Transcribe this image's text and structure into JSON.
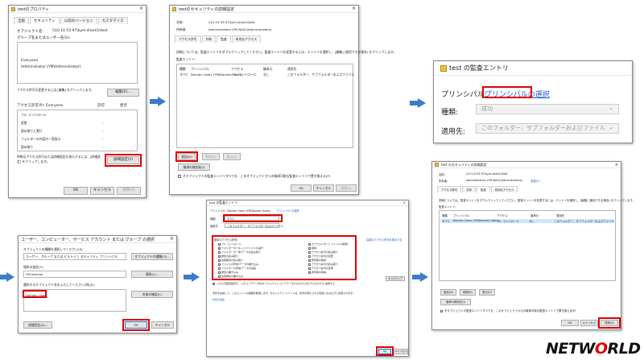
{
  "p1": {
    "title": "testのプロパティ",
    "tabs": [
      "全般",
      "セキュリティ",
      "以前のバージョン",
      "カスタマイズ"
    ],
    "object_label": "オブジェクト名:",
    "object_value": "\\\\10.10.53.97\\kym-share1\\test",
    "group_label": "グループ名またはユーザー名(G):",
    "users": [
      "Everyone",
      "Administrator (YM\\Administrator)"
    ],
    "change_text": "アクセス許可を変更するには [編集] をクリックします。",
    "edit_btn": "編集(E)...",
    "perm_label": "アクセス許可(P): Everyone",
    "allow": "許可",
    "deny": "拒否",
    "perms": [
      "フル コントロール",
      "変更",
      "読み取りと実行",
      "フォルダーの内容の一覧表示",
      "読み取り"
    ],
    "special_text": "特殊なアクセス許可または詳細設定を表示するには、[詳細設定] をクリックします。",
    "adv_btn": "詳細設定(V)",
    "ok": "OK",
    "cancel": "キャンセル",
    "apply": "適用(A)"
  },
  "p2": {
    "title": "testのセキュリティの詳細設定",
    "name_label": "名前:",
    "name_value": "\\\\10.10.53.97\\kym-share1\\test",
    "owner_label": "所有者:",
    "owner_value": "Administrators (YM-NAS1\\Administrators)",
    "tabs": [
      "アクセス許可",
      "共有",
      "監査",
      "有効なアクセス"
    ],
    "desc": "詳細については、監査エントリをダブルクリックしてください。監査エントリを変更するには、エントリを選択し、[編集] (使用できる場合) をクリックします。",
    "entries_label": "監査エントリ:",
    "cols": [
      "種類",
      "プリンシパル",
      "アクセス",
      "継承元",
      "適用先"
    ],
    "row": [
      "すべて",
      "Domain Users (YM\\Domain Users)",
      "フル コントロール",
      "なし",
      "このフォルダー、サブフォルダーおよびファイル"
    ],
    "add": "追加(D)",
    "remove": "削除(R)",
    "view": "表示(V)",
    "inherit_btn": "継承の無効化(I)",
    "replace_text": "子オブジェクトの監査エントリすべてを、このオブジェクトからの継承可能な監査エントリで置き換える(P)",
    "ok": "OK",
    "cancel": "キャンセル",
    "apply": "適用(A)"
  },
  "p3": {
    "title": "test の監査エントリ",
    "principal_label": "プリンシパル:",
    "principal_link": "プリンシパルの選択",
    "type_label": "種類:",
    "type_value": "成功",
    "apply_label": "適用先:",
    "apply_value": "このフォルダー、サブフォルダーおよびファイル"
  },
  "p4": {
    "title": "ユーザー、コンピューター、サービス アカウント または グループ の選択",
    "obj_type_label": "オブジェクトの種類を選択してください(S):",
    "obj_type_value": "ユーザー、グループ または ビルトイン セキュリティ プリンシパル",
    "obj_type_btn": "オブジェクトの種類(O)...",
    "location_label": "場所の指定(F):",
    "location_value": "YM.internal",
    "location_btn": "場所(L)...",
    "enter_label": "選択するオブジェクト名を入力してください(例)(E):",
    "entered": "Domain Users",
    "check_btn": "名前の確認(C)",
    "adv_btn": "詳細設定(A)...",
    "ok": "OK",
    "cancel": "キャンセル"
  },
  "p5": {
    "title": "test の監査エントリ",
    "principal": "プリンシパル: Domain Users (YM\\Domain Users)",
    "principal_link": "プリンシパルの選択",
    "type_label": "種類:",
    "type_value": "すべて",
    "apply_label": "適用先:",
    "apply_value": "このフォルダー、サブフォルダーおよびファイル",
    "basic_label": "基本のアクセス許可:",
    "show_adv": "高度なアクセス許可を表示する",
    "perms_left": [
      "フル コントロール",
      "フォルダーのスキャン/ファイルの実行",
      "フォルダーの一覧/データの読み取り",
      "属性の読み取り",
      "拡張属性の読み取り",
      "ファイルの作成/データの書き込み",
      "フォルダーの作成/データの追加",
      "属性の書き込み",
      "拡張属性の書き込み"
    ],
    "perms_right": [
      "サブフォルダーとファイルの削除",
      "削除",
      "アクセス許可の読み取り",
      "アクセス許可の変更",
      "所有権の取得",
      "アクセス許可の読み取り",
      "アクセス許可の変更",
      "所有権の取得"
    ],
    "clear_btn": "すべてクリア",
    "only_text": "これらの監査設定を、このコンテナー内のオブジェクトとコンテナーまたはそれらのどちらかだけに適用する",
    "cond_text": "条件を追加して、このエントリの範囲を制限します。セキュリティ イベントは、条件が満たされる場合にのみログに記録されます。",
    "cond_link": "条件の追加",
    "ok": "OK",
    "cancel": "キャンセル"
  },
  "p6": {
    "title": "test のセキュリティの詳細設定",
    "name_label": "名前:",
    "name_value": "\\\\10.10.53.97\\kym-share1\\test",
    "owner_label": "所有者:",
    "owner_value": "Administrators (YM-NAS1\\Administrators)",
    "owner_link": "変更(C)",
    "tabs": [
      "アクセス許可",
      "共有",
      "監査",
      "有効なアクセス"
    ],
    "desc": "詳細については、監査エントリをダブルクリックしてください。監査エントリを変更するには、エントリを選択し、[編集] (使用できる場合) をクリックします。",
    "entries_label": "監査エントリ:",
    "cols": [
      "種類",
      "プリンシパル",
      "アクセス",
      "継承元",
      "適用先"
    ],
    "row": [
      "すべて",
      "Domain Users (YM\\Domain Users)",
      "フル コントロール",
      "なし",
      "このフォルダー、サブフォルダーおよびファイル"
    ],
    "add": "追加(D)",
    "remove": "削除(R)",
    "view": "表示(V)",
    "inherit_btn": "継承の無効化(I)",
    "replace_text": "子オブジェクトの監査エントリすべてを、このオブジェクトからの継承可能な監査エントリで置き換える(P)",
    "ok": "OK",
    "cancel": "キャンセル",
    "apply": "適用(A)"
  },
  "logo": {
    "pre": "NETW",
    "o": "O",
    "post": "RLD"
  }
}
